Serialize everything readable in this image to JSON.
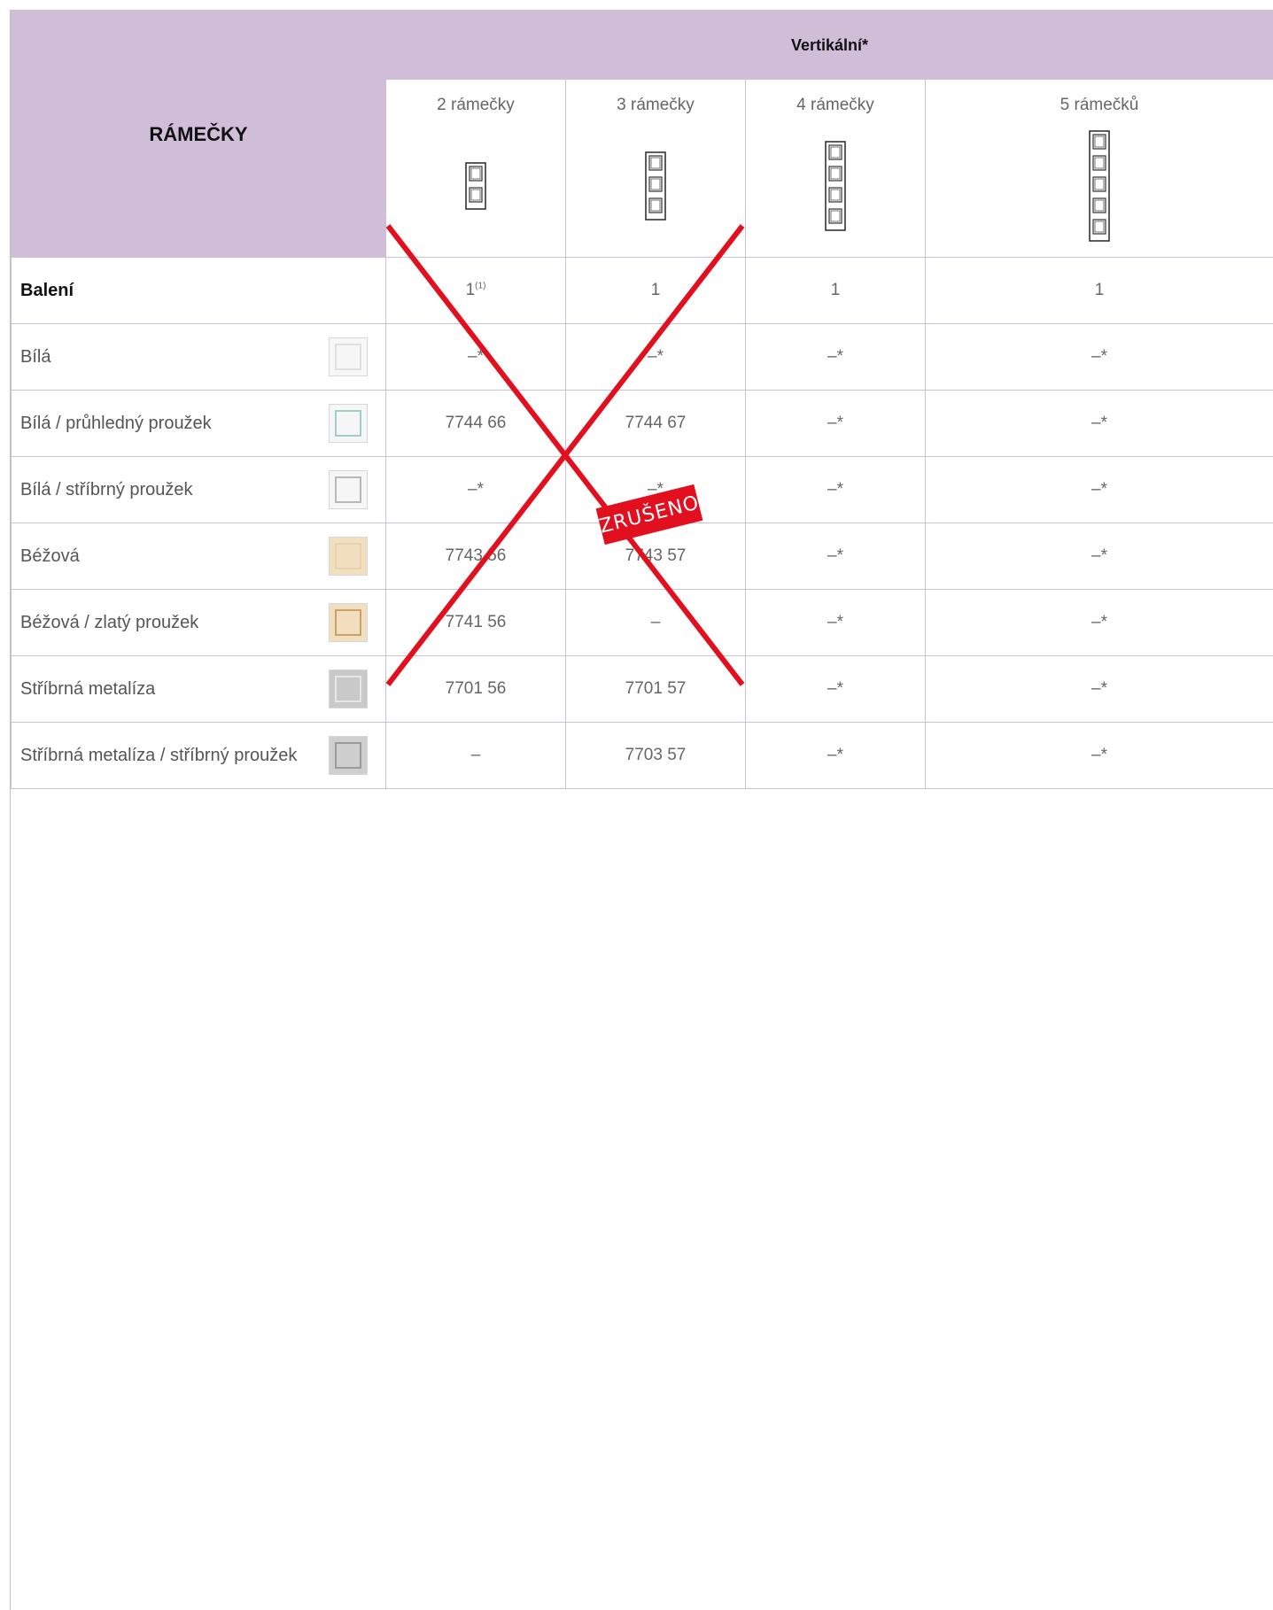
{
  "table": {
    "title": "RÁMEČKY",
    "group_header": "Vertikální*",
    "columns": [
      {
        "label": "2 rámečky",
        "icon": "vertical-frame-2-icon"
      },
      {
        "label": "3 rámečky",
        "icon": "vertical-frame-3-icon"
      },
      {
        "label": "4 rámečky",
        "icon": "vertical-frame-4-icon"
      },
      {
        "label": "5 rámečků",
        "icon": "vertical-frame-5-icon"
      }
    ],
    "packaging": {
      "label": "Balení",
      "values": [
        "1",
        "1",
        "1",
        "1"
      ],
      "footnote": "(1)"
    },
    "rows": [
      {
        "label": "Bílá",
        "swatch": "#f7f7f7",
        "swatch_border": "#e0e0e0",
        "values": [
          "–*",
          "–*",
          "–*",
          "–*"
        ]
      },
      {
        "label": "Bílá / průhledný proužek",
        "swatch": "#f6f6f6",
        "swatch_border": "#9fd0c8",
        "values": [
          "7744 66",
          "7744 67",
          "–*",
          "–*"
        ]
      },
      {
        "label": "Bílá / stříbrný proužek",
        "swatch": "#f6f6f6",
        "swatch_border": "#b8b8b8",
        "values": [
          "–*",
          "–*",
          "–*",
          "–*"
        ]
      },
      {
        "label": "Béžová",
        "swatch": "#f1dfbf",
        "swatch_border": "#e6d3b0",
        "values": [
          "7743 56",
          "7743 57",
          "–*",
          "–*"
        ]
      },
      {
        "label": "Béžová / zlatý proužek",
        "swatch": "#f1dfbf",
        "swatch_border": "#c9a36a",
        "values": [
          "7741 56",
          "–",
          "–*",
          "–*"
        ]
      },
      {
        "label": "Stříbrná metalíza",
        "swatch": "#c9c9c9",
        "swatch_border": "#e6e6e6",
        "values": [
          "7701 56",
          "7701 57",
          "–*",
          "–*"
        ]
      },
      {
        "label": "Stříbrná metalíza / stříbrný proužek",
        "swatch": "#cfcfcf",
        "swatch_border": "#9a9a9a",
        "values": [
          "–",
          "7703 57",
          "–*",
          "–*"
        ]
      }
    ]
  },
  "stamp": {
    "text": "ZRUŠENO",
    "color": "#e2101f"
  },
  "colors": {
    "header_bg": "#d0bed9",
    "grid": "#cbc1d3",
    "cross": "#e2101f"
  }
}
